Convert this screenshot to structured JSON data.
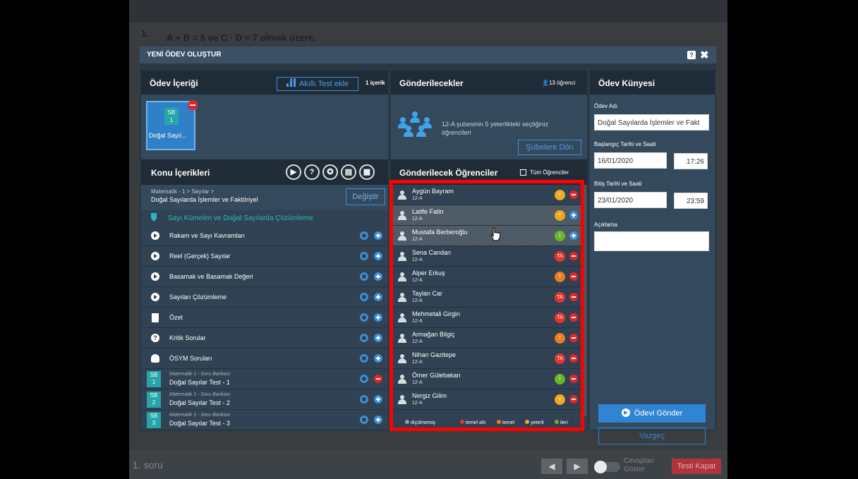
{
  "background": {
    "question_number": "1.",
    "question_text": "A + B = 5  ve  C · D = 7  olmak üzere,",
    "footer_label": "1. soru",
    "nav_prev": "◀",
    "nav_next": "▶",
    "toggle_label": "Cevapları Göster",
    "close_test_label": "Testi Kapat"
  },
  "modal": {
    "title": "YENİ ÖDEV OLUŞTUR",
    "help_label": "?",
    "close_label": "✖"
  },
  "content": {
    "title": "Ödev İçeriği",
    "add_test_label": "Akıllı Test ekle",
    "count_label": "1 içerik",
    "tile": {
      "badge_top": "SB",
      "badge_num": "1",
      "label": "Doğal Sayıl..."
    }
  },
  "topics": {
    "title": "Konu İçerikleri",
    "toolbar_icons": [
      {
        "name": "play-circle-icon",
        "glyph": "▶"
      },
      {
        "name": "question-circle-icon",
        "glyph": "?"
      },
      {
        "name": "badge-circle-icon",
        "glyph": "✪"
      },
      {
        "name": "document-circle-icon",
        "glyph": "▤"
      },
      {
        "name": "grid-circle-icon",
        "glyph": "▦"
      }
    ],
    "path_small": "Matematik - 1 > Sayılar >",
    "path_main": "Doğal Sayılarda İşlemler ve Faktöriyel",
    "change_label": "Değiştir",
    "section_label": "Sayı Kümeleri ve Doğal Sayılarda Çözümleme",
    "rows": [
      {
        "icon": "play",
        "label": "Rakam ve Sayı Kavramları",
        "action": "add"
      },
      {
        "icon": "play",
        "label": "Reel (Gerçek) Sayılar",
        "action": "add"
      },
      {
        "icon": "play",
        "label": "Basamak ve Basamak Değeri",
        "action": "add"
      },
      {
        "icon": "play",
        "label": "Sayıları Çözümleme",
        "action": "add"
      },
      {
        "icon": "doc",
        "label": "Özet",
        "action": "add"
      },
      {
        "icon": "q",
        "label": "Kritik Sorular",
        "action": "add"
      },
      {
        "icon": "badge",
        "label": "ÖSYM Soruları",
        "action": "add"
      }
    ],
    "bank_rows": [
      {
        "badge_top": "SB",
        "badge_num": "1",
        "small": "Matematik 1 - Soru Bankası",
        "main": "Doğal Sayılar Test - 1",
        "action": "remove"
      },
      {
        "badge_top": "SB",
        "badge_num": "2",
        "small": "Matematik 1 - Soru Bankası",
        "main": "Doğal Sayılar Test - 2",
        "action": "add"
      },
      {
        "badge_top": "SB",
        "badge_num": "3",
        "small": "Matematik 1 - Soru Bankası",
        "main": "Doğal Sayılar Test - 3",
        "action": "add"
      }
    ]
  },
  "recipients": {
    "title": "Gönderilecekler",
    "count_label": "13 öğrenci",
    "group_text": "12-A şubesinin 5 yeterlikteki seçtiğiniz öğrencileri",
    "back_label": "Şubelere Dön",
    "students_title": "Gönderilecek Öğrenciler",
    "all_label": "Tüm Öğrenciler",
    "students": [
      {
        "name": "Aygün Bayram",
        "class": "12-A",
        "level": "Y",
        "level_color": "#f0a81e",
        "action": "remove",
        "selected": false
      },
      {
        "name": "Latife Fatin",
        "class": "12-A",
        "level": "Y",
        "level_color": "#f0a81e",
        "action": "add",
        "selected": true
      },
      {
        "name": "Mustafa Berberoğlu",
        "class": "12-A",
        "level": "İ",
        "level_color": "#6ab52b",
        "action": "add",
        "selected": true
      },
      {
        "name": "Sena Candan",
        "class": "12-A",
        "level": "TA",
        "level_color": "#e5372b",
        "action": "remove",
        "selected": false
      },
      {
        "name": "Alper Erkuş",
        "class": "12-A",
        "level": "T",
        "level_color": "#f07a1e",
        "action": "remove",
        "selected": false
      },
      {
        "name": "Taylan Car",
        "class": "12-A",
        "level": "TA",
        "level_color": "#e5372b",
        "action": "remove",
        "selected": false
      },
      {
        "name": "Mehmetali Girgin",
        "class": "12-A",
        "level": "TA",
        "level_color": "#e5372b",
        "action": "remove",
        "selected": false
      },
      {
        "name": "Armağan Bilgiç",
        "class": "12-A",
        "level": "T",
        "level_color": "#f07a1e",
        "action": "remove",
        "selected": false
      },
      {
        "name": "Nihan Gazitepe",
        "class": "12-A",
        "level": "TA",
        "level_color": "#e5372b",
        "action": "remove",
        "selected": false
      },
      {
        "name": "Ömer Gülebakan",
        "class": "12-A",
        "level": "İ",
        "level_color": "#6ab52b",
        "action": "remove",
        "selected": false
      },
      {
        "name": "Nergiz Gilim",
        "class": "12-A",
        "level": "Y",
        "level_color": "#f0a81e",
        "action": "remove",
        "selected": false
      }
    ],
    "legend": [
      {
        "label": "ölçülmemiş",
        "color": "#9a9fa5"
      },
      {
        "label": "temel altı",
        "color": "#e5372b"
      },
      {
        "label": "temel",
        "color": "#f07a1e"
      },
      {
        "label": "yeterli",
        "color": "#f0a81e"
      },
      {
        "label": "ileri",
        "color": "#6ab52b"
      }
    ]
  },
  "info": {
    "title": "Ödev Künyesi",
    "name_label": "Ödev Adı",
    "name_value": "Doğal Sayılarda İşlemler ve Fakt",
    "start_label": "Başlangıç Tarihi ve Saati",
    "start_date": "16/01/2020",
    "start_time": "17:26",
    "end_label": "Bitiş Tarihi ve Saati",
    "end_date": "23/01/2020",
    "end_time": "23:59",
    "desc_label": "Açıklama",
    "desc_value": "",
    "send_label": "Ödevi Gönder",
    "cancel_label": "Vazgeç"
  }
}
